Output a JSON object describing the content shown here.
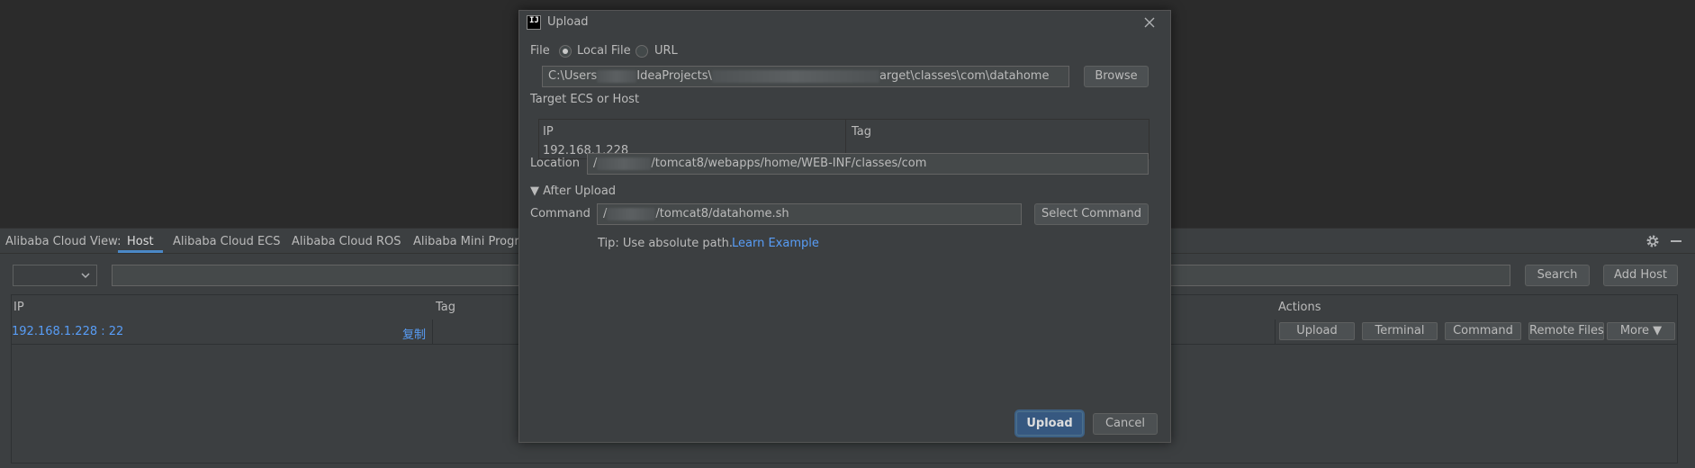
{
  "tool_window": {
    "title": "Alibaba Cloud View:",
    "tabs": [
      {
        "label": "Host"
      },
      {
        "label": "Alibaba Cloud ECS"
      },
      {
        "label": "Alibaba Cloud ROS"
      },
      {
        "label": "Alibaba Mini Progra"
      }
    ],
    "search_button": "Search",
    "add_host_button": "Add Host",
    "table": {
      "columns": {
        "ip": "IP",
        "tag": "Tag",
        "actions": "Actions"
      },
      "rows": [
        {
          "ip": "192.168.1.228 : 22",
          "copy": "复制"
        }
      ],
      "row_actions": [
        "Upload",
        "Terminal",
        "Command",
        "Remote Files",
        "More ▼"
      ]
    }
  },
  "dialog": {
    "title": "Upload",
    "file_label": "File",
    "local_file_label": "Local File",
    "url_label": "URL",
    "path_part1": "C:\\Users",
    "path_part2": "IdeaProjects\\",
    "path_part3": "arget\\classes\\com\\datahome",
    "browse_button": "Browse",
    "target_label": "Target ECS or Host",
    "host_table": {
      "col_ip": "IP",
      "col_tag": "Tag",
      "ip_value": "192.168.1.228"
    },
    "location_label": "Location",
    "location_prefix": "/",
    "location_value": "/tomcat8/webapps/home/WEB-INF/classes/com",
    "after_upload_label": "▼ After Upload",
    "command_label": "Command",
    "command_prefix": "/",
    "command_value": "/tomcat8/datahome.sh",
    "select_command_button": "Select Command",
    "tip_text": "Tip: Use absolute path.",
    "learn_example_link": "Learn Example",
    "upload_button": "Upload",
    "cancel_button": "Cancel"
  },
  "colors": {
    "accent": "#4a88c7",
    "link": "#589df6",
    "primary_button": "#365880"
  }
}
